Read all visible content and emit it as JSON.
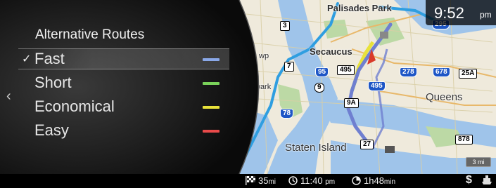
{
  "clock": {
    "time": "9:52",
    "ampm": "pm"
  },
  "panel": {
    "title": "Alternative Routes",
    "back_icon": "chevron-left-icon",
    "routes": [
      {
        "label": "Fast",
        "selected": true,
        "check": "✓",
        "color": "#8aa8e8"
      },
      {
        "label": "Short",
        "selected": false,
        "check": "",
        "color": "#7ad25a"
      },
      {
        "label": "Economical",
        "selected": false,
        "check": "",
        "color": "#e8e23a"
      },
      {
        "label": "Easy",
        "selected": false,
        "check": "",
        "color": "#e84a4a"
      }
    ]
  },
  "map": {
    "places": [
      "Palisades Park",
      "Secaucus",
      "wp",
      "wark",
      "Queens",
      "Staten Island"
    ],
    "shields": [
      "295",
      "3",
      "7",
      "9",
      "95",
      "495",
      "278",
      "678",
      "25A",
      "9A",
      "495",
      "78",
      "878",
      "27"
    ],
    "scale": "3 mi"
  },
  "status": {
    "distance_value": "35",
    "distance_unit": "mi",
    "eta_value": "11:40",
    "eta_unit": "pm",
    "duration": "1h48",
    "duration_unit": "min",
    "toll_symbol": "$",
    "icons": [
      "checkered-flag-icon",
      "clock-icon",
      "stopwatch-icon",
      "toll-icon",
      "ferry-icon"
    ]
  },
  "colors": {
    "route_blue": "#5b7fd6",
    "highway_cyan": "#2f9ee0",
    "water": "#9bc2e8",
    "land": "#f1ede2",
    "park": "#b9d8a2"
  }
}
